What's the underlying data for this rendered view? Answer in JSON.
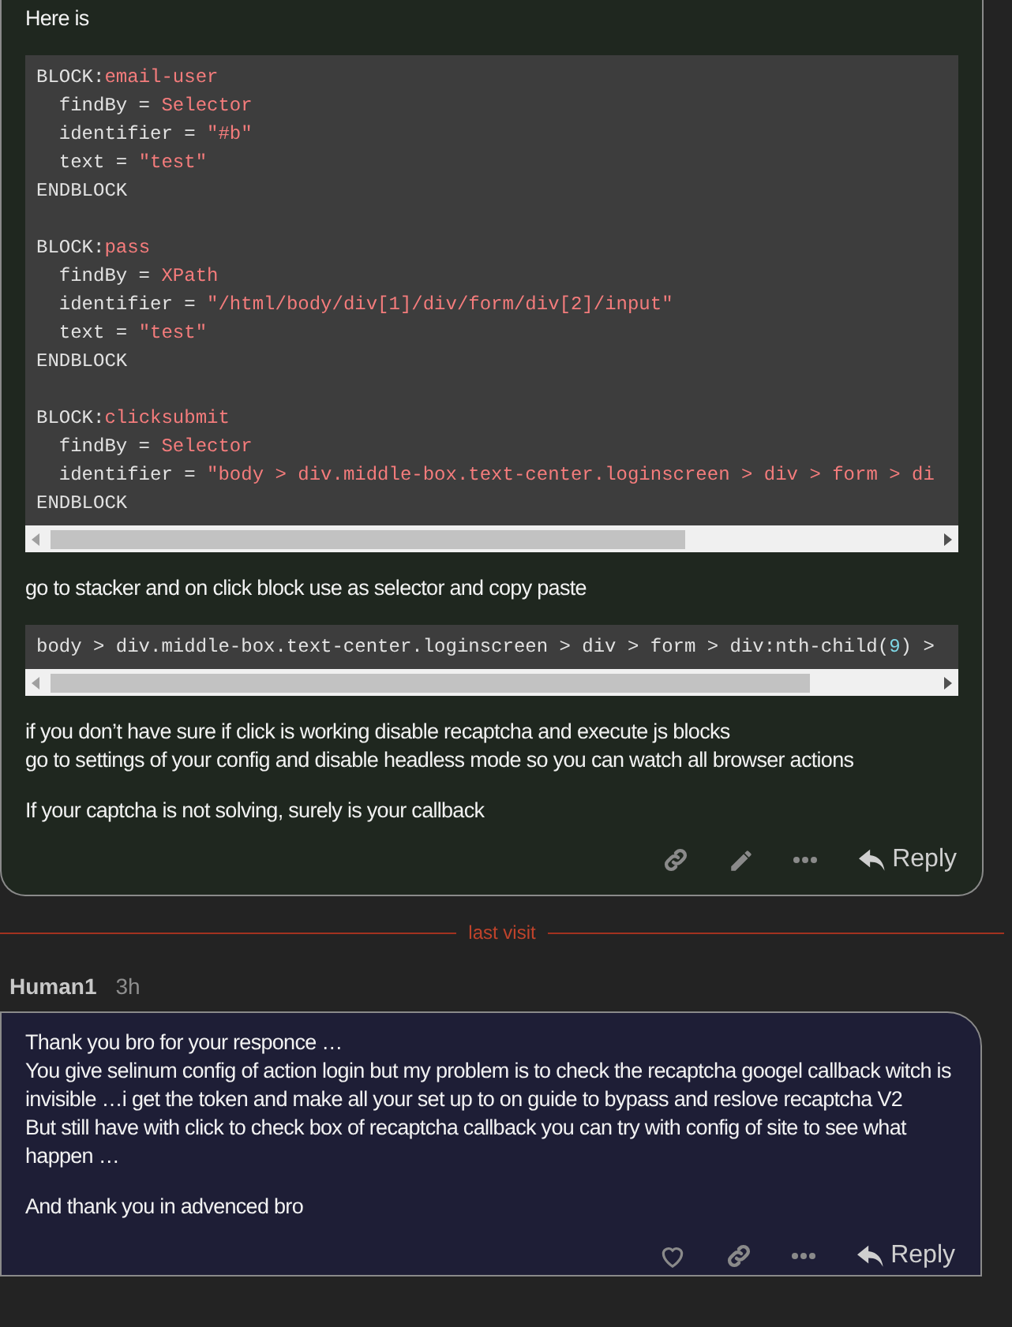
{
  "posts": [
    {
      "kind": "reply",
      "blocks": [
        {
          "kind": "paragraph",
          "text": "Here is"
        },
        {
          "kind": "code",
          "groups": [
            [
              [
                {
                  "t": "BLOCK:",
                  "kind": "plain"
                },
                {
                  "t": "email-user",
                  "kind": "string"
                }
              ],
              [
                {
                  "t": "  findBy = ",
                  "kind": "plain"
                },
                {
                  "t": "Selector",
                  "kind": "string"
                }
              ],
              [
                {
                  "t": "  identifier = ",
                  "kind": "plain"
                },
                {
                  "t": "\"#b\"",
                  "kind": "string"
                }
              ],
              [
                {
                  "t": "  text = ",
                  "kind": "plain"
                },
                {
                  "t": "\"test\"",
                  "kind": "string"
                }
              ],
              [
                {
                  "t": "ENDBLOCK",
                  "kind": "plain"
                }
              ]
            ],
            [
              [
                {
                  "t": "BLOCK:",
                  "kind": "plain"
                },
                {
                  "t": "pass",
                  "kind": "string"
                }
              ],
              [
                {
                  "t": "  findBy = ",
                  "kind": "plain"
                },
                {
                  "t": "XPath",
                  "kind": "string"
                }
              ],
              [
                {
                  "t": "  identifier = ",
                  "kind": "plain"
                },
                {
                  "t": "\"/html/body/div[1]/div/form/div[2]/input\"",
                  "kind": "string"
                }
              ],
              [
                {
                  "t": "  text = ",
                  "kind": "plain"
                },
                {
                  "t": "\"test\"",
                  "kind": "string"
                }
              ],
              [
                {
                  "t": "ENDBLOCK",
                  "kind": "plain"
                }
              ]
            ],
            [
              [
                {
                  "t": "BLOCK:",
                  "kind": "plain"
                },
                {
                  "t": "clicksubmit",
                  "kind": "string"
                }
              ],
              [
                {
                  "t": "  findBy = ",
                  "kind": "plain"
                },
                {
                  "t": "Selector",
                  "kind": "string"
                }
              ],
              [
                {
                  "t": "  identifier = ",
                  "kind": "plain"
                },
                {
                  "t": "\"body > div.middle-box.text-center.loginscreen > div > form > di",
                  "kind": "string"
                }
              ],
              [
                {
                  "t": "ENDBLOCK",
                  "kind": "plain"
                }
              ]
            ]
          ]
        },
        {
          "kind": "paragraph",
          "text": "go to stacker and on click block use as selector and copy paste"
        },
        {
          "kind": "code",
          "groups": [
            [
              [
                {
                  "t": "body > div.middle-box.text-center.loginscreen > div > form > div:nth-child(",
                  "kind": "plain"
                },
                {
                  "t": "9",
                  "kind": "number"
                },
                {
                  "t": ") >",
                  "kind": "plain"
                }
              ]
            ]
          ]
        },
        {
          "kind": "paragraph",
          "text": "if you don’t have sure if click is working disable recaptcha and execute js blocks\ngo to settings of your config and disable headless mode so you can watch all browser actions"
        },
        {
          "kind": "paragraph",
          "text": "If your captcha is not solving, surely is your callback"
        }
      ],
      "actions": [
        {
          "kind": "link"
        },
        {
          "kind": "edit"
        },
        {
          "kind": "more"
        },
        {
          "kind": "reply",
          "label": "Reply"
        }
      ]
    },
    {
      "kind": "divider",
      "label": "last visit"
    },
    {
      "kind": "post",
      "author": "Human1",
      "time": "3h",
      "blocks": [
        {
          "kind": "paragraph",
          "text": "Thank you bro for your responce …\nYou give selinum config of action login but my problem is to check the recaptcha googel callback witch is invisible …i get the token and make all your set up to on guide to bypass and reslove recaptcha V2\nBut still have with click to check box of recaptcha callback you can try with config of site to see what happen …"
        },
        {
          "kind": "paragraph",
          "text": "And thank you in advenced bro"
        }
      ],
      "actions": [
        {
          "kind": "like"
        },
        {
          "kind": "link"
        },
        {
          "kind": "more"
        },
        {
          "kind": "reply",
          "label": "Reply"
        }
      ]
    }
  ]
}
